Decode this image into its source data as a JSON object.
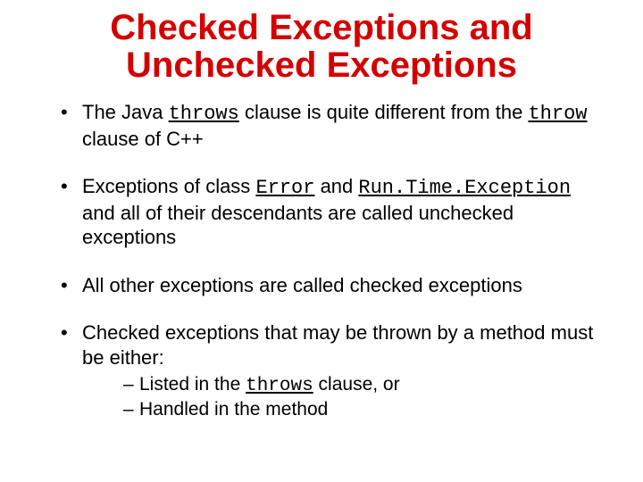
{
  "title_line1": "Checked Exceptions and",
  "title_line2": "Unchecked Exceptions",
  "bullets": {
    "b1": {
      "t1": "The Java ",
      "code1": "throws",
      "t2": " clause is quite different from the ",
      "code2": "throw",
      "t3": " clause of C++"
    },
    "b2": {
      "t1": "Exceptions of class ",
      "code1": "Error",
      "t2": " and ",
      "code2": "Run.Time.Exception",
      "t3": " and all of their descendants are called unchecked exceptions"
    },
    "b3": "All other exceptions are called checked exceptions",
    "b4": {
      "t1": "Checked exceptions that may be thrown by a method must be either:",
      "s1_t1": "Listed in the ",
      "s1_code": "throws",
      "s1_t2": " clause, or",
      "s2": "Handled in the method"
    }
  }
}
